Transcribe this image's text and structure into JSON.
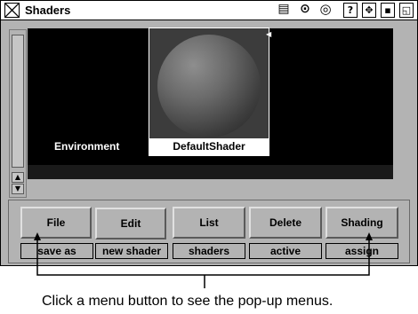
{
  "window": {
    "title": "Shaders",
    "title_buttons": [
      {
        "icon": "list-icon",
        "glyph": "▤"
      },
      {
        "icon": "target-icon",
        "glyph": "⊙"
      },
      {
        "icon": "dial-icon",
        "glyph": "◎"
      },
      {
        "icon": "help-icon",
        "glyph": "?"
      },
      {
        "icon": "move-icon",
        "glyph": "✥"
      },
      {
        "icon": "minimize-icon",
        "glyph": "▪"
      },
      {
        "icon": "maximize-icon",
        "glyph": "◱"
      }
    ]
  },
  "scrollbar": {
    "up_glyph": "▲",
    "down_glyph": "▼"
  },
  "canvas": {
    "environment_label": "Environment",
    "shader_name": "DefaultShader",
    "selected_marker": "◀"
  },
  "menus": [
    {
      "label": "File",
      "sub": "save as"
    },
    {
      "label": "Edit",
      "sub": "new shader"
    },
    {
      "label": "List",
      "sub": "shaders"
    },
    {
      "label": "Delete",
      "sub": "active"
    },
    {
      "label": "Shading",
      "sub": "assign"
    }
  ],
  "caption": "Click a menu button to see the pop-up menus."
}
